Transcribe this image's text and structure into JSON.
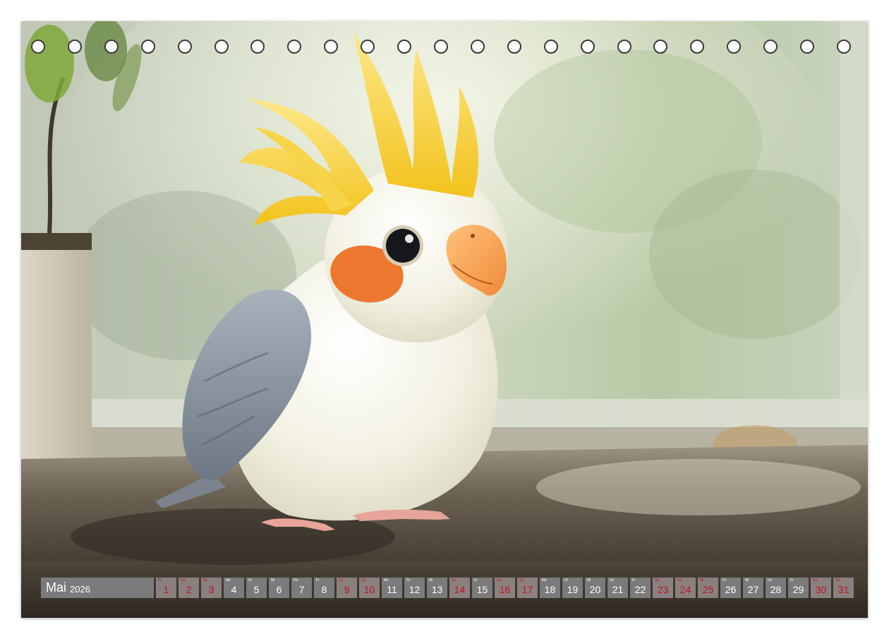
{
  "calendar": {
    "month": "Mai",
    "year": "2026",
    "days": [
      {
        "num": "1",
        "dow": "Fr",
        "type": "holiday"
      },
      {
        "num": "2",
        "dow": "Sa",
        "type": "weekend"
      },
      {
        "num": "3",
        "dow": "So",
        "type": "weekend"
      },
      {
        "num": "4",
        "dow": "Mo",
        "type": "weekday"
      },
      {
        "num": "5",
        "dow": "Di",
        "type": "weekday"
      },
      {
        "num": "6",
        "dow": "Mi",
        "type": "weekday"
      },
      {
        "num": "7",
        "dow": "Do",
        "type": "weekday"
      },
      {
        "num": "8",
        "dow": "Fr",
        "type": "weekday"
      },
      {
        "num": "9",
        "dow": "Sa",
        "type": "weekend"
      },
      {
        "num": "10",
        "dow": "So",
        "type": "weekend"
      },
      {
        "num": "11",
        "dow": "Mo",
        "type": "weekday"
      },
      {
        "num": "12",
        "dow": "Di",
        "type": "weekday"
      },
      {
        "num": "13",
        "dow": "Mi",
        "type": "weekday"
      },
      {
        "num": "14",
        "dow": "Do",
        "type": "holiday"
      },
      {
        "num": "15",
        "dow": "Fr",
        "type": "weekday"
      },
      {
        "num": "16",
        "dow": "Sa",
        "type": "weekend"
      },
      {
        "num": "17",
        "dow": "So",
        "type": "weekend"
      },
      {
        "num": "18",
        "dow": "Mo",
        "type": "weekday"
      },
      {
        "num": "19",
        "dow": "Di",
        "type": "weekday"
      },
      {
        "num": "20",
        "dow": "Mi",
        "type": "weekday"
      },
      {
        "num": "21",
        "dow": "Do",
        "type": "weekday"
      },
      {
        "num": "22",
        "dow": "Fr",
        "type": "weekday"
      },
      {
        "num": "23",
        "dow": "Sa",
        "type": "weekend"
      },
      {
        "num": "24",
        "dow": "So",
        "type": "weekend"
      },
      {
        "num": "25",
        "dow": "Mo",
        "type": "holiday"
      },
      {
        "num": "26",
        "dow": "Di",
        "type": "weekday"
      },
      {
        "num": "27",
        "dow": "Mi",
        "type": "weekday"
      },
      {
        "num": "28",
        "dow": "Do",
        "type": "weekday"
      },
      {
        "num": "29",
        "dow": "Fr",
        "type": "weekday"
      },
      {
        "num": "30",
        "dow": "Sa",
        "type": "weekend"
      },
      {
        "num": "31",
        "dow": "So",
        "type": "weekend"
      }
    ]
  },
  "binding_hole_count": 23,
  "colors": {
    "cell_bg": "#7b7b7b",
    "weekend_red": "#c0121e",
    "crest_yellow": "#f6cf2a",
    "cheek_orange": "#ec6d1e",
    "wing_grey": "#8f99a4"
  }
}
